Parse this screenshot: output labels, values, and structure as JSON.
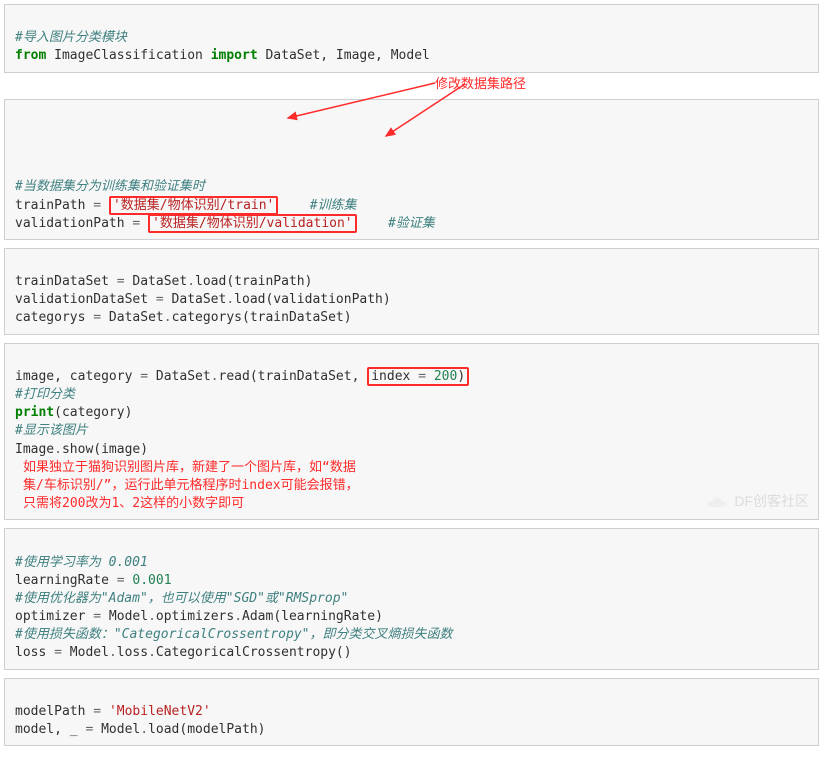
{
  "cell1": {
    "comment": "#导入图片分类模块",
    "kw_from": "from",
    "module": "ImageClassification",
    "kw_import": "import",
    "imports": "DataSet, Image, Model"
  },
  "ann_top": "修改数据集路径",
  "cell2": {
    "comment1": "#当数据集分为训练集和验证集时",
    "var1": "trainPath",
    "eq": " = ",
    "str1": "'数据集/物体识别/train'",
    "tail1": "#训练集",
    "var2": "validationPath",
    "str2": "'数据集/物体识别/validation'",
    "tail2": "#验证集"
  },
  "cell3": {
    "l1a": "trainDataSet ",
    "l1b": "=",
    "l1c": " DataSet",
    "l1d": ".",
    "l1e": "load(trainPath)",
    "l2a": "validationDataSet ",
    "l2b": "=",
    "l2c": " DataSet",
    "l2d": ".",
    "l2e": "load(validationPath)",
    "l3a": "categorys ",
    "l3b": "=",
    "l3c": " DataSet",
    "l3d": ".",
    "l3e": "categorys(trainDataSet)"
  },
  "cell4": {
    "l1a": "image, category ",
    "l1b": "=",
    "l1c": " DataSet",
    "l1d": ".",
    "l1e": "read(trainDataSet, ",
    "index_kw": "index ",
    "index_eq": "=",
    "index_sp": " ",
    "index_val": "200",
    "l1z": ")",
    "ann_side": "如果独立于猫狗识别图片库，新建了一个图片库，如“数据集/车标识别/”，运行此单元格程序时index可能会报错，只需将200改为1、2这样的小数字即可",
    "c_print": "#打印分类",
    "kw_print": "print",
    "print_arg": "(category)",
    "c_show": "#显示该图片",
    "show_a": "Image",
    "show_b": ".",
    "show_c": "show(image)"
  },
  "cell5": {
    "c1": "#使用学习率为 0.001",
    "lr_a": "learningRate ",
    "lr_b": "=",
    "lr_c": " ",
    "lr_val": "0.001",
    "c2": "#使用优化器为\"Adam\"，也可以使用\"SGD\"或\"RMSprop\"",
    "opt_a": "optimizer ",
    "opt_b": "=",
    "opt_c": " Model",
    "opt_d": ".",
    "opt_e": "optimizers",
    "opt_f": ".",
    "opt_g": "Adam(learningRate)",
    "c3": "#使用损失函数：\"CategoricalCrossentropy\"，即分类交叉熵损失函数",
    "loss_a": "loss ",
    "loss_b": "=",
    "loss_c": " Model",
    "loss_d": ".",
    "loss_e": "loss",
    "loss_f": ".",
    "loss_g": "CategoricalCrossentropy()"
  },
  "cell6": {
    "mp_a": "modelPath ",
    "mp_b": "=",
    "mp_c": " ",
    "mp_str": "'MobileNetV2'",
    "mdl_a": "model, _ ",
    "mdl_b": "=",
    "mdl_c": " Model",
    "mdl_d": ".",
    "mdl_e": "load(modelPath)"
  },
  "watermark": "DF创客社区"
}
